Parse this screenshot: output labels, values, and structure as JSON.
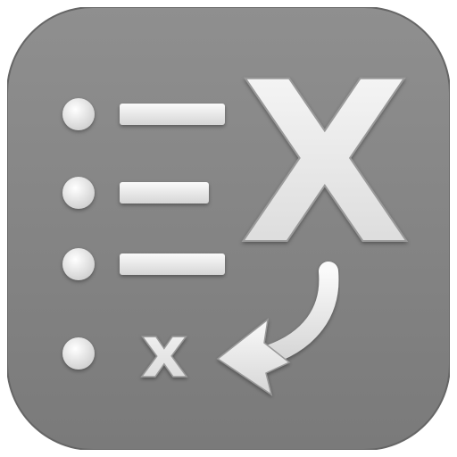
{
  "icon": {
    "name": "list-to-x-app-icon",
    "large_glyph": "X",
    "small_glyph": "x",
    "list_item_count": 4,
    "colors": {
      "background": "#8a8a8a",
      "background_dark": "#6f6f6f",
      "foreground": "#f4f4f4",
      "foreground_shade": "#cfcfcf"
    }
  }
}
